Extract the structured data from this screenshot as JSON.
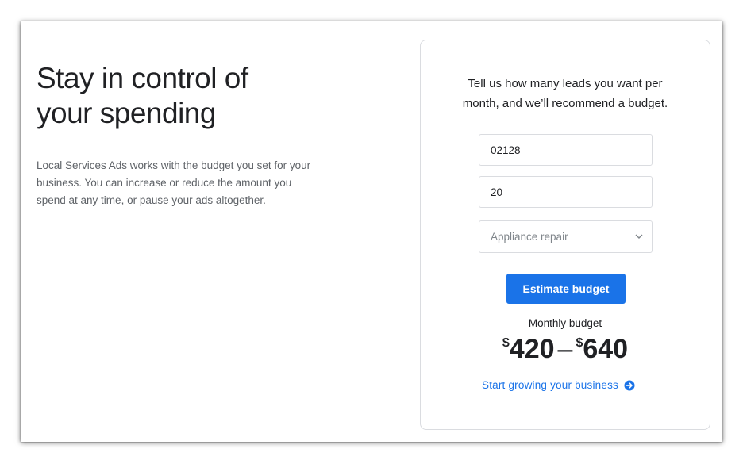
{
  "hero": {
    "headline_line1": "Stay in control of",
    "headline_line2": "your spending",
    "body": "Local Services Ads works with the budget you set for your business. You can increase or reduce the amount you spend at any time, or pause your ads altogether."
  },
  "estimator": {
    "prompt_line1": "Tell us how many leads you want per",
    "prompt_line2": "month, and we’ll recommend a budget.",
    "zip_value": "02128",
    "leads_value": "20",
    "category_selected": "Appliance repair",
    "estimate_button_label": "Estimate budget",
    "budget_label": "Monthly budget",
    "budget_currency": "$",
    "budget_min": "420",
    "budget_separator": "–",
    "budget_max": "640",
    "cta_label": "Start growing your business"
  },
  "colors": {
    "accent": "#1a73e8",
    "text_primary": "#202124",
    "text_secondary": "#5f6368",
    "border": "#dadce0"
  },
  "icons": {
    "select_chevron": "chevron-down-icon",
    "cta_arrow": "arrow-right-circle-icon"
  }
}
